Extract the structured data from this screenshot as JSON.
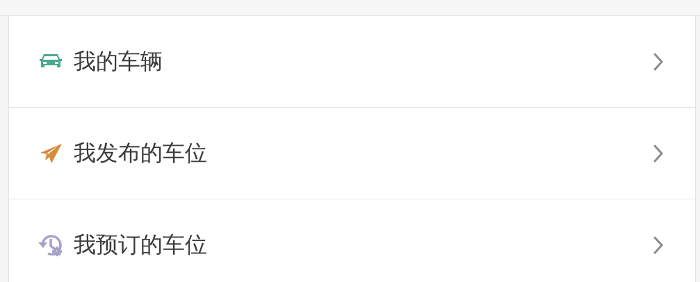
{
  "menu": [
    {
      "label": "我的车辆",
      "kind": "car",
      "color": "#4aa88f"
    },
    {
      "label": "我发布的车位",
      "kind": "plane",
      "color": "#d9893a"
    },
    {
      "label": "我预订的车位",
      "kind": "history",
      "color": "#a4a2c9"
    }
  ]
}
